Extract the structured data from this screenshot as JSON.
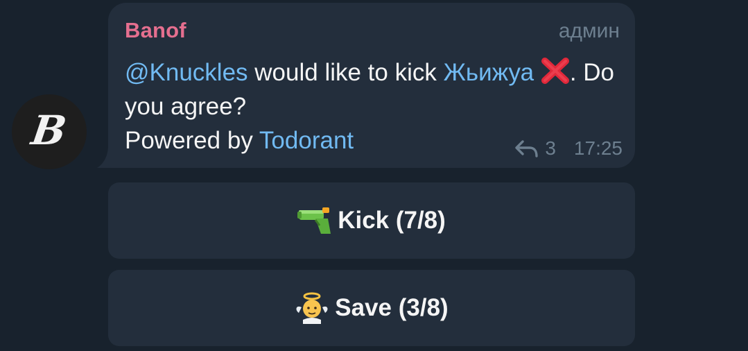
{
  "message": {
    "sender": "Banof",
    "role": "админ",
    "mention": "@Knuckles",
    "text_middle": " would like to kick ",
    "target": "Жьижуа",
    "cross_icon": "cross-mark-icon",
    "text_after": ". Do you agree?",
    "powered_prefix": "Powered by ",
    "powered_link": "Todorant",
    "reply_icon": "reply-arrow-icon",
    "reply_count": "3",
    "time": "17:25"
  },
  "avatar": {
    "letter": "B"
  },
  "buttons": [
    {
      "icon": "water-pistol-icon",
      "label": "Kick (7/8)"
    },
    {
      "icon": "baby-angel-icon",
      "label": "Save (3/8)"
    }
  ],
  "colors": {
    "background": "#18222d",
    "bubble": "#232e3c",
    "sender": "#e56f8f",
    "link": "#71baf2",
    "meta": "#6d7f8f",
    "text": "#f5f5f5"
  }
}
